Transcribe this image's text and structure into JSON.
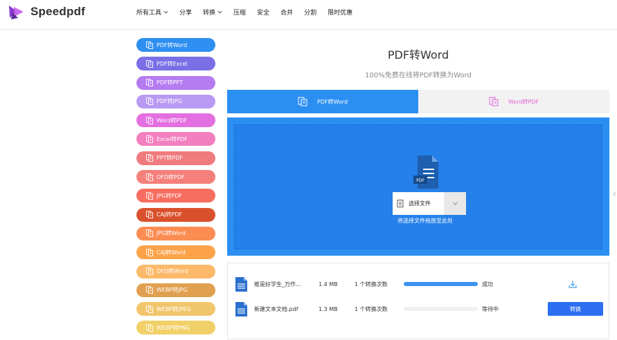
{
  "brand": {
    "name": "Speedpdf"
  },
  "nav": [
    {
      "label": "所有工具",
      "has_dropdown": true
    },
    {
      "label": "分享",
      "has_dropdown": false
    },
    {
      "label": "转换",
      "has_dropdown": true
    },
    {
      "label": "压缩",
      "has_dropdown": false
    },
    {
      "label": "安全",
      "has_dropdown": false
    },
    {
      "label": "合并",
      "has_dropdown": false
    },
    {
      "label": "分割",
      "has_dropdown": false
    },
    {
      "label": "限时优惠",
      "has_dropdown": false
    }
  ],
  "sidebar": {
    "items": [
      {
        "label": "PDF转Word",
        "color": "#2f8ff0"
      },
      {
        "label": "PDF转Excel",
        "color": "#7b6fe6"
      },
      {
        "label": "PDF转PPT",
        "color": "#b57bf0"
      },
      {
        "label": "PDF转JPG",
        "color": "#b89af2"
      },
      {
        "label": "Word转PDF",
        "color": "#e46fe0"
      },
      {
        "label": "Excel转PDF",
        "color": "#f27fbf"
      },
      {
        "label": "PPT转PDF",
        "color": "#f07b7e"
      },
      {
        "label": "OFD转PDF",
        "color": "#f57f7a"
      },
      {
        "label": "JPG转PDF",
        "color": "#f76d5f"
      },
      {
        "label": "CAJ转PDF",
        "color": "#d9512c"
      },
      {
        "label": "JPG转Word",
        "color": "#fb8c52"
      },
      {
        "label": "CAJ转Word",
        "color": "#fca34a"
      },
      {
        "label": "OFD转Word",
        "color": "#fdb96a"
      },
      {
        "label": "WEBP转JPG",
        "color": "#e0a050"
      },
      {
        "label": "WEBP转JPEG",
        "color": "#f1c56c"
      },
      {
        "label": "WEBP转PNG",
        "color": "#f2d069"
      }
    ]
  },
  "main": {
    "title": "PDF转Word",
    "subtitle": "100%免费在线将PDF转换为Word",
    "tabs": [
      {
        "label": "PDF转Word",
        "active": true
      },
      {
        "label": "Word转PDF",
        "active": false
      }
    ],
    "upload": {
      "file_type_badge": "PDF",
      "select_label": "选择文件",
      "hint": "将选择文件拖放至此处"
    },
    "files": [
      {
        "name": "推是好学生_万作...",
        "size": "1.4 MB",
        "count": "1 个转换次数",
        "progress": 1.0,
        "status": "成功",
        "action": "download"
      },
      {
        "name": "新建文本文档.pdf",
        "size": "1.3 MB",
        "count": "1 个转换次数",
        "progress": 0.0,
        "status": "等待中",
        "action": "转换"
      }
    ]
  }
}
